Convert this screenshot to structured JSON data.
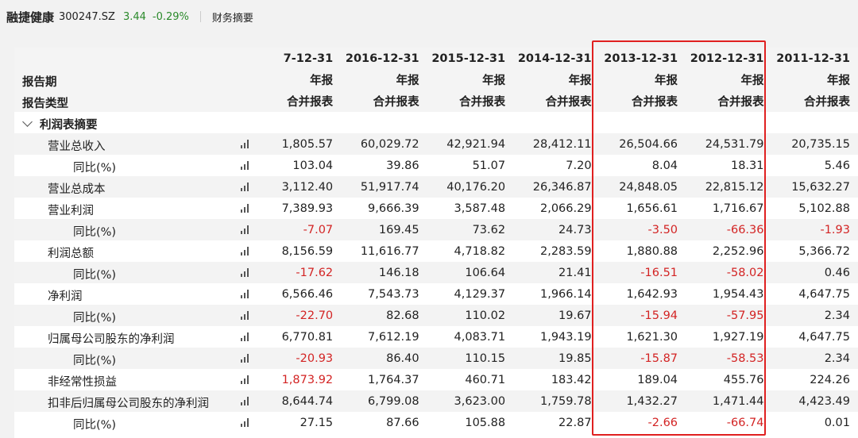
{
  "header": {
    "stock_name": "融捷健康",
    "stock_code": "300247.SZ",
    "price": "3.44",
    "change": "-0.29%",
    "tab": "财务摘要"
  },
  "table": {
    "dates": [
      "7-12-31",
      "2016-12-31",
      "2015-12-31",
      "2014-12-31",
      "2013-12-31",
      "2012-12-31",
      "2011-12-31"
    ],
    "period_label": "报告期",
    "period": [
      "年报",
      "年报",
      "年报",
      "年报",
      "年报",
      "年报",
      "年报"
    ],
    "type_label": "报告类型",
    "types": [
      "合并报表",
      "合并报表",
      "合并报表",
      "合并报表",
      "合并报表",
      "合并报表",
      "合并报表"
    ],
    "section": "利润表摘要",
    "rows": [
      {
        "label": "营业总收入",
        "indent": 1,
        "values": [
          "1,805.57",
          "60,029.72",
          "42,921.94",
          "28,412.11",
          "26,504.66",
          "24,531.79",
          "20,735.15"
        ]
      },
      {
        "label": "同比(%)",
        "indent": 2,
        "values": [
          "103.04",
          "39.86",
          "51.07",
          "7.20",
          "8.04",
          "18.31",
          "5.46"
        ]
      },
      {
        "label": "营业总成本",
        "indent": 1,
        "values": [
          "3,112.40",
          "51,917.74",
          "40,176.20",
          "26,346.87",
          "24,848.05",
          "22,815.12",
          "15,632.27"
        ]
      },
      {
        "label": "营业利润",
        "indent": 1,
        "values": [
          "7,389.93",
          "9,666.39",
          "3,587.48",
          "2,066.29",
          "1,656.61",
          "1,716.67",
          "5,102.88"
        ]
      },
      {
        "label": "同比(%)",
        "indent": 2,
        "values": [
          "-7.07",
          "169.45",
          "73.62",
          "24.73",
          "-3.50",
          "-66.36",
          "-1.93"
        ]
      },
      {
        "label": "利润总额",
        "indent": 1,
        "values": [
          "8,156.59",
          "11,616.77",
          "4,718.82",
          "2,283.59",
          "1,880.88",
          "2,252.96",
          "5,366.72"
        ]
      },
      {
        "label": "同比(%)",
        "indent": 2,
        "values": [
          "-17.62",
          "146.18",
          "106.64",
          "21.41",
          "-16.51",
          "-58.02",
          "0.46"
        ]
      },
      {
        "label": "净利润",
        "indent": 1,
        "values": [
          "6,566.46",
          "7,543.73",
          "4,129.37",
          "1,966.14",
          "1,642.93",
          "1,954.43",
          "4,647.75"
        ]
      },
      {
        "label": "同比(%)",
        "indent": 2,
        "values": [
          "-22.70",
          "82.68",
          "110.02",
          "19.67",
          "-15.94",
          "-57.95",
          "2.34"
        ]
      },
      {
        "label": "归属母公司股东的净利润",
        "indent": 1,
        "values": [
          "6,770.81",
          "7,612.19",
          "4,083.71",
          "1,943.19",
          "1,621.30",
          "1,927.19",
          "4,647.75"
        ]
      },
      {
        "label": "同比(%)",
        "indent": 2,
        "values": [
          "-20.93",
          "86.40",
          "110.15",
          "19.85",
          "-15.87",
          "-58.53",
          "2.34"
        ]
      },
      {
        "label": "非经常性损益",
        "indent": 1,
        "values": [
          "1,873.92",
          "1,764.37",
          "460.71",
          "183.42",
          "189.04",
          "455.76",
          "224.26"
        ],
        "first_red": true
      },
      {
        "label": "扣非后归属母公司股东的净利润",
        "indent": 1,
        "values": [
          "8,644.74",
          "6,799.08",
          "3,623.00",
          "1,759.78",
          "1,432.27",
          "1,471.44",
          "4,423.49"
        ]
      },
      {
        "label": "同比(%)",
        "indent": 2,
        "values": [
          "27.15",
          "87.66",
          "105.88",
          "22.87",
          "-2.66",
          "-66.74",
          "0.01"
        ]
      }
    ]
  },
  "colors": {
    "negative": "#d32424",
    "up_green": "#2b8a2b",
    "highlight_border": "#e02020"
  },
  "icons": {
    "row_chart": "bar-chart-icon",
    "section_toggle": "chevron-down-icon"
  }
}
